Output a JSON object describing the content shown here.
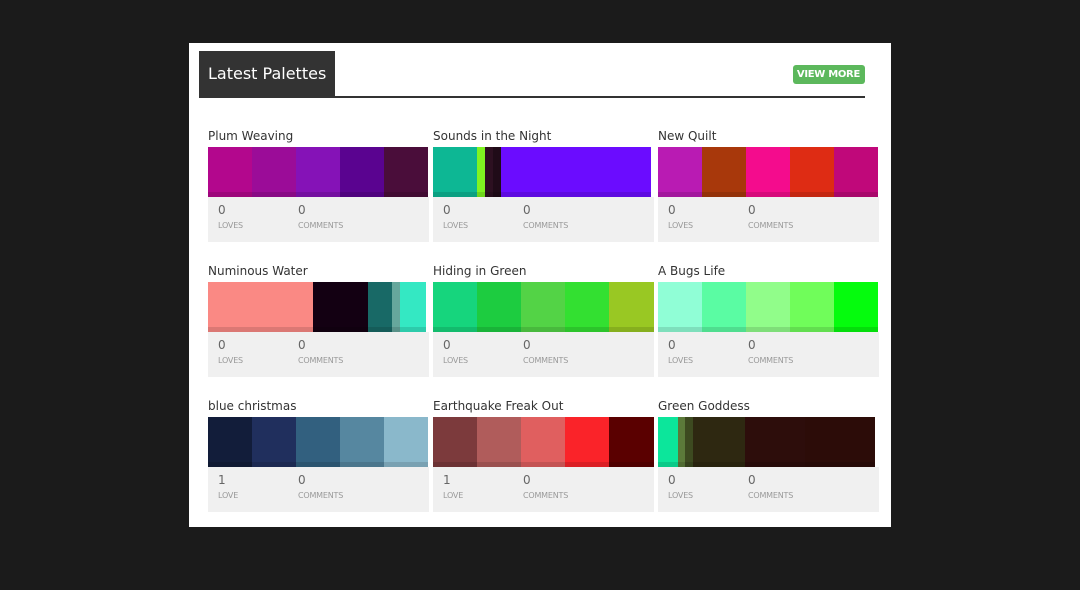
{
  "header": {
    "title": "Latest Palettes",
    "view_more": "VIEW MORE"
  },
  "palettes": [
    {
      "name": "Plum Weaving",
      "colors": [
        "#b3078d",
        "#9b0c98",
        "#8512b7",
        "#5a0390",
        "#4a0d3a"
      ],
      "loves": "0",
      "loves_label": "LOVES",
      "comments": "0",
      "comments_label": "COMMENTS"
    },
    {
      "name": "Sounds in the Night",
      "colors": [
        "#0db794",
        "#7ff321",
        "#2d1021",
        "#200b18",
        "#6b0cff"
      ],
      "loves": "0",
      "loves_label": "LOVES",
      "comments": "0",
      "comments_label": "COMMENTS"
    },
    {
      "name": "New Quilt",
      "colors": [
        "#b91bb3",
        "#a8380b",
        "#f40c8d",
        "#de2c14",
        "#c0087a"
      ],
      "loves": "0",
      "loves_label": "LOVES",
      "comments": "0",
      "comments_label": "COMMENTS"
    },
    {
      "name": "Numinous Water",
      "colors": [
        "#fa8984",
        "#130012",
        "#186966",
        "#66a79c",
        "#34e8c3"
      ],
      "loves": "0",
      "loves_label": "LOVES",
      "comments": "0",
      "comments_label": "COMMENTS"
    },
    {
      "name": "Hiding in Green",
      "colors": [
        "#16d57d",
        "#1dcc40",
        "#53d346",
        "#33e031",
        "#99c823"
      ],
      "loves": "0",
      "loves_label": "LOVES",
      "comments": "0",
      "comments_label": "COMMENTS"
    },
    {
      "name": "A Bugs Life",
      "colors": [
        "#90fed6",
        "#5afca3",
        "#91fd8a",
        "#70fd5a",
        "#05fc0d"
      ],
      "loves": "0",
      "loves_label": "LOVES",
      "comments": "0",
      "comments_label": "COMMENTS"
    },
    {
      "name": "blue christmas",
      "colors": [
        "#121d3a",
        "#202f5d",
        "#32607f",
        "#5687a0",
        "#8ab8cb"
      ],
      "loves": "1",
      "loves_label": "LOVE",
      "comments": "0",
      "comments_label": "COMMENTS"
    },
    {
      "name": "Earthquake Freak Out",
      "colors": [
        "#7c3a3c",
        "#b05c5b",
        "#e05f5f",
        "#fa2329",
        "#5a0000"
      ],
      "loves": "1",
      "loves_label": "LOVE",
      "comments": "0",
      "comments_label": "COMMENTS"
    },
    {
      "name": "Green Goddess",
      "colors": [
        "#0ce69b",
        "#5c7a3a",
        "#3d4a20",
        "#2e2811",
        "#2d0d0b",
        "#2c0c08"
      ],
      "loves": "0",
      "loves_label": "LOVES",
      "comments": "0",
      "comments_label": "COMMENTS"
    }
  ]
}
